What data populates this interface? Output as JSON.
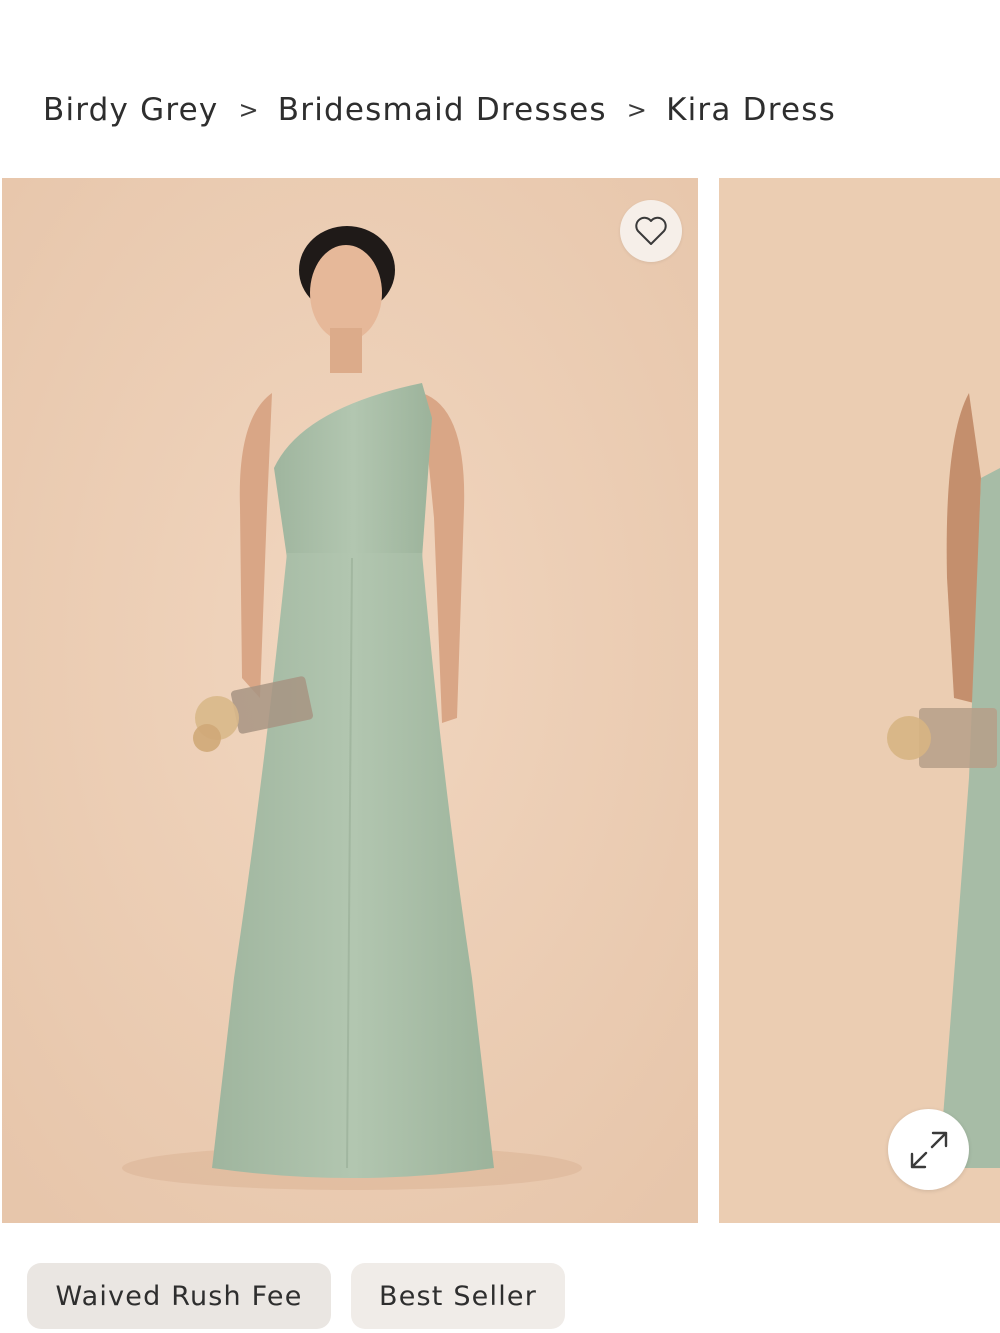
{
  "breadcrumb": {
    "items": [
      "Birdy Grey",
      "Bridesmaid Dresses",
      "Kira Dress"
    ],
    "separator": ">"
  },
  "gallery": {
    "background_color": "#edcfb4",
    "dress_color": "#a9bfa8",
    "favorite_icon": "heart-outline-icon",
    "expand_icon": "expand-arrows-icon"
  },
  "badges": [
    "Waived Rush Fee",
    "Best Seller"
  ]
}
